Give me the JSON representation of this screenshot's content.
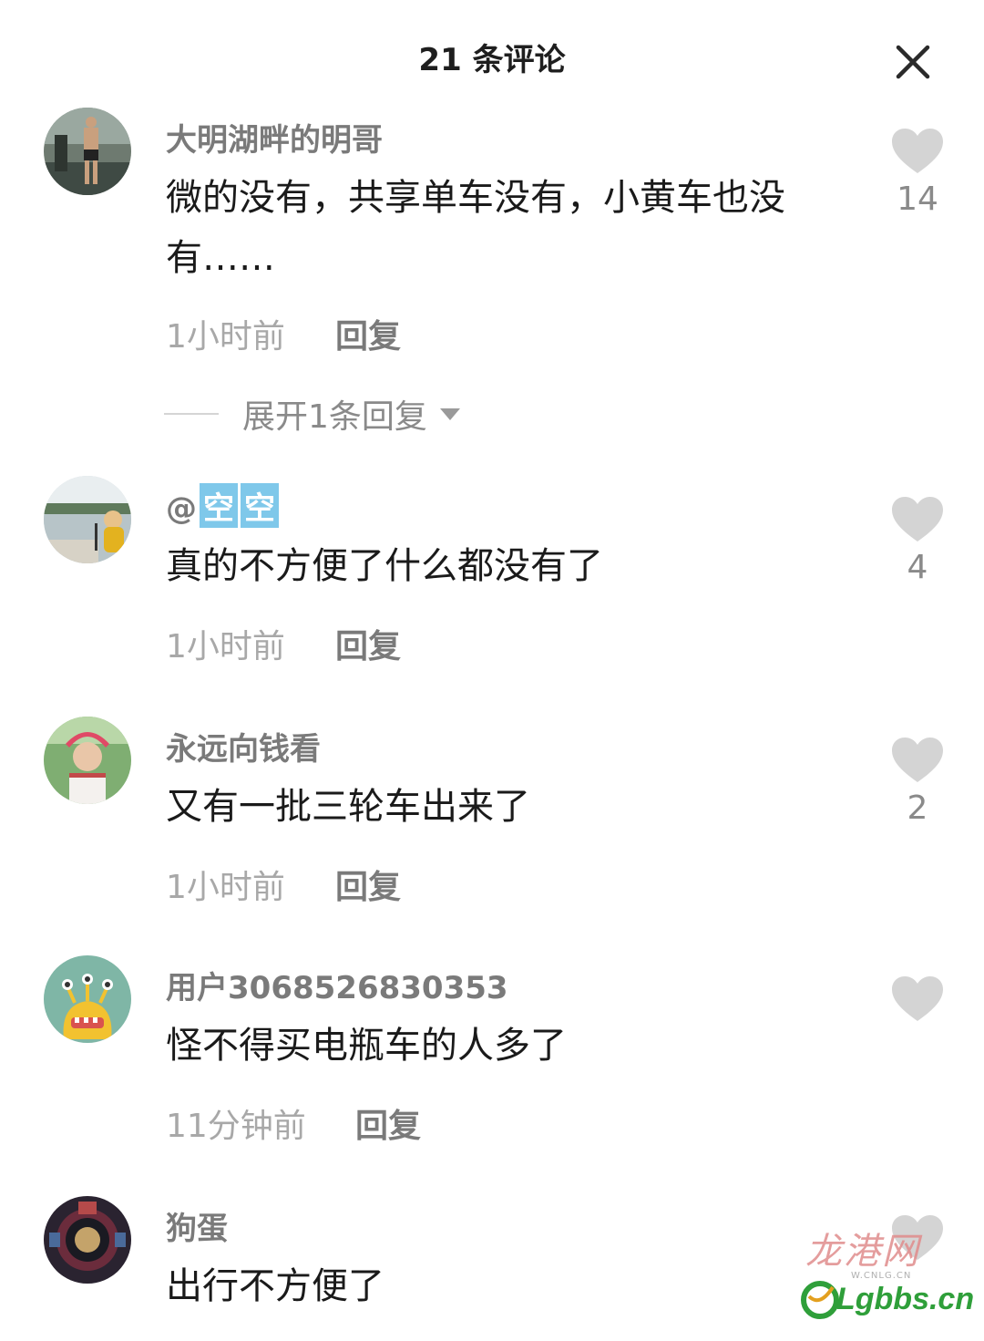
{
  "header": {
    "title": "21 条评论",
    "close_icon": "close-icon"
  },
  "colors": {
    "username": "#7a7a7a",
    "meta": "#a8a8a8",
    "heart": "#d4d4d4",
    "mention_bg": "#7fc8ea"
  },
  "comments": [
    {
      "user": "大明湖畔的明哥",
      "text": "微的没有，共享单车没有，小黄车也没有……",
      "time": "1小时前",
      "reply": "回复",
      "likes": "14",
      "expand": "展开1条回复"
    },
    {
      "user": "@",
      "mention": [
        "空",
        "空"
      ],
      "text": "真的不方便了什么都没有了",
      "time": "1小时前",
      "reply": "回复",
      "likes": "4"
    },
    {
      "user": "永远向钱看",
      "text": "又有一批三轮车出来了",
      "time": "1小时前",
      "reply": "回复",
      "likes": "2"
    },
    {
      "user": "用户3068526830353",
      "text": "怪不得买电瓶车的人多了",
      "time": "11分钟前",
      "reply": "回复",
      "likes": ""
    },
    {
      "user": "狗蛋",
      "text": "出行不方便了",
      "time": "",
      "reply": "",
      "likes": ""
    }
  ],
  "watermark": {
    "cn": "龙港网",
    "small": "W.CNLG.CN",
    "en": "Lgbbs.cn"
  }
}
